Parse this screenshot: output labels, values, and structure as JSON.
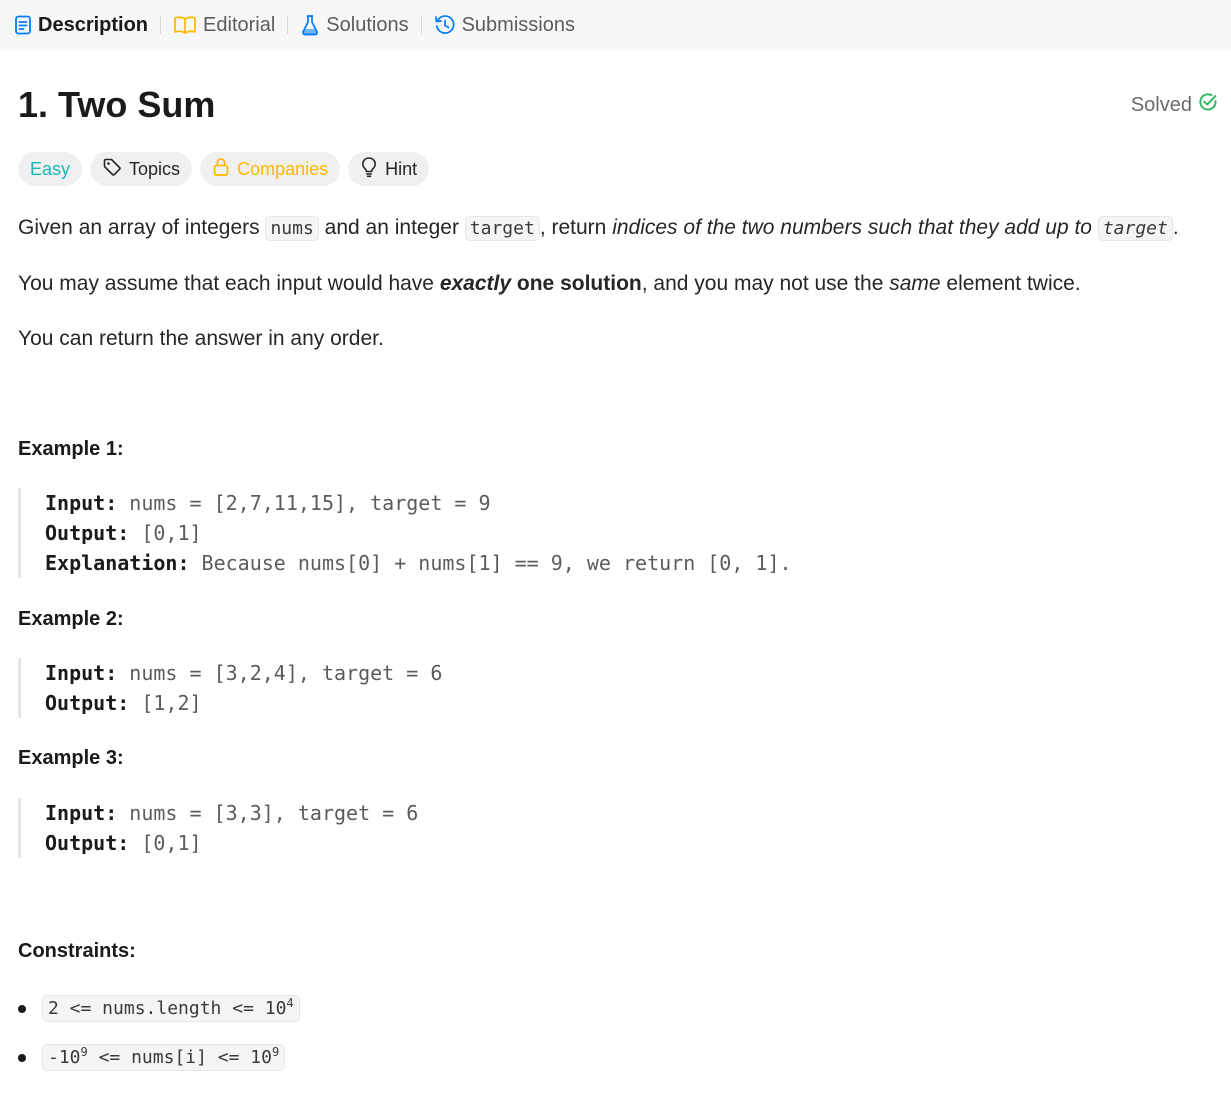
{
  "tabs": [
    {
      "label": "Description",
      "icon": "description-icon",
      "active": true
    },
    {
      "label": "Editorial",
      "icon": "book-icon",
      "active": false
    },
    {
      "label": "Solutions",
      "icon": "flask-icon",
      "active": false
    },
    {
      "label": "Submissions",
      "icon": "history-icon",
      "active": false
    }
  ],
  "problem": {
    "title": "1. Two Sum",
    "status": "Solved",
    "chips": {
      "difficulty": "Easy",
      "topics": "Topics",
      "companies": "Companies",
      "hint": "Hint"
    }
  },
  "description": {
    "p1": {
      "t1": "Given an array of integers ",
      "c1": "nums",
      "t2": " and an integer ",
      "c2": "target",
      "t3": ", return ",
      "it": "indices of the two numbers such that they add up to",
      "t4": " ",
      "c3": "target",
      "t5": "."
    },
    "p2": {
      "t1": "You may assume that each input would have ",
      "bi": "exactly",
      "b": " one solution",
      "t2": ", and you may not use the ",
      "it": "same",
      "t3": " element twice."
    },
    "p3": "You can return the answer in any order."
  },
  "examples": [
    {
      "heading": "Example 1:",
      "input_label": "Input:",
      "input": "nums = [2,7,11,15], target = 9",
      "output_label": "Output:",
      "output": "[0,1]",
      "explanation_label": "Explanation:",
      "explanation": "Because nums[0] + nums[1] == 9, we return [0, 1]."
    },
    {
      "heading": "Example 2:",
      "input_label": "Input:",
      "input": "nums = [3,2,4], target = 6",
      "output_label": "Output:",
      "output": "[1,2]"
    },
    {
      "heading": "Example 3:",
      "input_label": "Input:",
      "input": "nums = [3,3], target = 6",
      "output_label": "Output:",
      "output": "[0,1]"
    }
  ],
  "constraints": {
    "heading": "Constraints:",
    "c1": {
      "pre": "2 <= nums.length <= 10",
      "exp": "4"
    },
    "c2": {
      "pre": "-10",
      "exp1": "9",
      "mid": " <= nums[i] <= 10",
      "exp2": "9"
    }
  },
  "colors": {
    "easy": "#1cb8b8",
    "companies": "#ffb800",
    "solved": "#2db55d",
    "description_tab_icon": "#007aff"
  }
}
